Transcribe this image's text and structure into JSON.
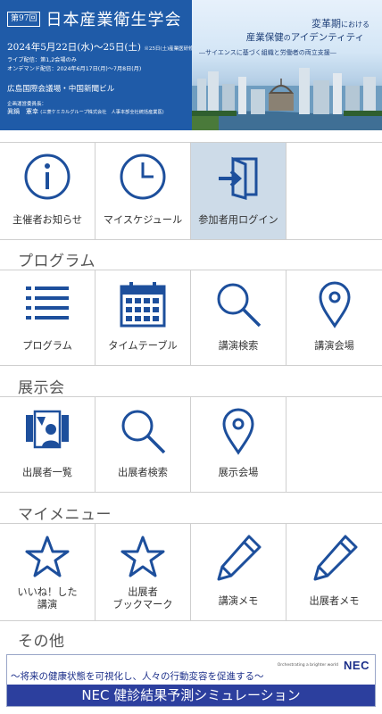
{
  "banner": {
    "edition": "第97回",
    "title": "日本産業衛生学会",
    "date": "2024年5月22日(水)～25日(土)",
    "date_note": "※25日(土)産業医研修会",
    "live_note": "ライブ配信：第1,2会場のみ",
    "ondemand_note": "オンデマンド配信：2024年6月17日(月)～7月8日(月)",
    "venue": "広島国際会議場・中国新聞ビル",
    "chair_label": "企画運営委員長：",
    "chair_name": "眞鍋　憲幸",
    "chair_affiliation": "(三菱ケミカルグループ株式会社　人事本部全社統括産業医)",
    "theme_line1_small": "変革期",
    "theme_line1_mid": "における",
    "theme_line2_main": "産業保健",
    "theme_line2_mid": "の",
    "theme_line2_end": "アイデンティティ",
    "theme_line3": "―サイエンスに基づく組織と労働者の両立支援―"
  },
  "top_menu": [
    {
      "label": "主催者お知らせ",
      "icon": "info-icon"
    },
    {
      "label": "マイスケジュール",
      "icon": "clock-icon"
    },
    {
      "label": "参加者用ログイン",
      "icon": "login-icon"
    }
  ],
  "sections": {
    "program": "プログラム",
    "exhibition": "展示会",
    "my_menu": "マイメニュー",
    "other": "その他"
  },
  "program_menu": [
    {
      "label": "プログラム",
      "icon": "list-icon"
    },
    {
      "label": "タイムテーブル",
      "icon": "calendar-icon"
    },
    {
      "label": "講演検索",
      "icon": "search-icon"
    },
    {
      "label": "講演会場",
      "icon": "map-pin-icon"
    }
  ],
  "exhibition_menu": [
    {
      "label": "出展者一覧",
      "icon": "exhibitor-booth-icon"
    },
    {
      "label": "出展者検索",
      "icon": "search-icon"
    },
    {
      "label": "展示会場",
      "icon": "map-pin-icon"
    }
  ],
  "my_menu": [
    {
      "label_1": "いいね！した",
      "label_2": "講演",
      "icon": "star-icon"
    },
    {
      "label_1": "出展者",
      "label_2": "ブックマーク",
      "icon": "star-icon"
    },
    {
      "label": "講演メモ",
      "icon": "pencil-icon"
    },
    {
      "label": "出展者メモ",
      "icon": "pencil-icon"
    }
  ],
  "ad": {
    "tagline": "～将来の健康状態を可視化し、人々の行動変容を促進する～",
    "slogan": "Orchestrating a brighter world",
    "logo": "NEC",
    "cta": "NEC 健診結果予測シミュレーション"
  },
  "colors": {
    "banner_blue": "#1f5ba8",
    "icon_blue": "#1d4f9c",
    "active_cell": "#cddbe8",
    "ad_bar": "#2c3f9e"
  }
}
